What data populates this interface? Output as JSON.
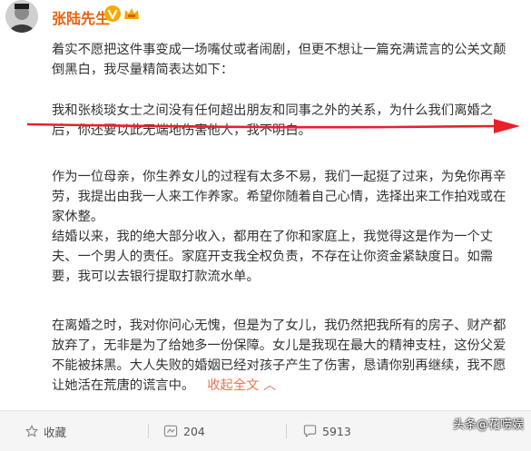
{
  "post": {
    "author": "张陆先生",
    "paragraphs": {
      "p1": "着实不愿把这件事变成一场嘴仗或者闹剧，但更不想让一篇充满谎言的公关文颠倒黑白，我尽量精简表达如下：",
      "p2": "我和张棪琰女士之间没有任何超出朋友和同事之外的关系，为什么我们离婚之后，你还要以此无端地伤害他人，我不明白。",
      "p3": "作为一位母亲，你生养女儿的过程有太多不易，我们一起挺了过来，为免你再辛劳，我提出由我一人来工作养家。希望你随着自己心情，选择出来工作拍戏或在家休整。",
      "p4": "结婚以来，我的绝大部分收入，都用在了你和家庭上，我觉得这是作为一个丈夫、一个男人的责任。家庭开支我全权负责，不存在让你资金紧缺度日。如需要，我可以去银行提取打款流水单。",
      "p5": "在离婚之时，我对你问心无愧，但是为了女儿，我仍然把我所有的房子、财产都放弃了，无非是为了给她多一份保障。女儿是我现在最大的精神支柱，这份父爱不能被抹黑。大人失败的婚姻已经对孩子产生了伤害，恳请你别再继续，我不愿让她活在荒唐的谎言中。"
    },
    "collapse_label": "收起全文",
    "collapse_glyph": "︿"
  },
  "actions": {
    "favorite_label": "收藏",
    "repost_count": "204",
    "comment_count": "5913"
  },
  "watermark": "头条@花唠娱",
  "colors": {
    "username": "#e8630a",
    "link": "#eb7350",
    "annotation": "#e8202a",
    "vip_badge": "#f7a900"
  },
  "icons": {
    "verified": "verified-v-icon",
    "member": "crown-icon",
    "favorite": "star-icon",
    "repost": "repost-icon",
    "comment": "comment-icon"
  }
}
